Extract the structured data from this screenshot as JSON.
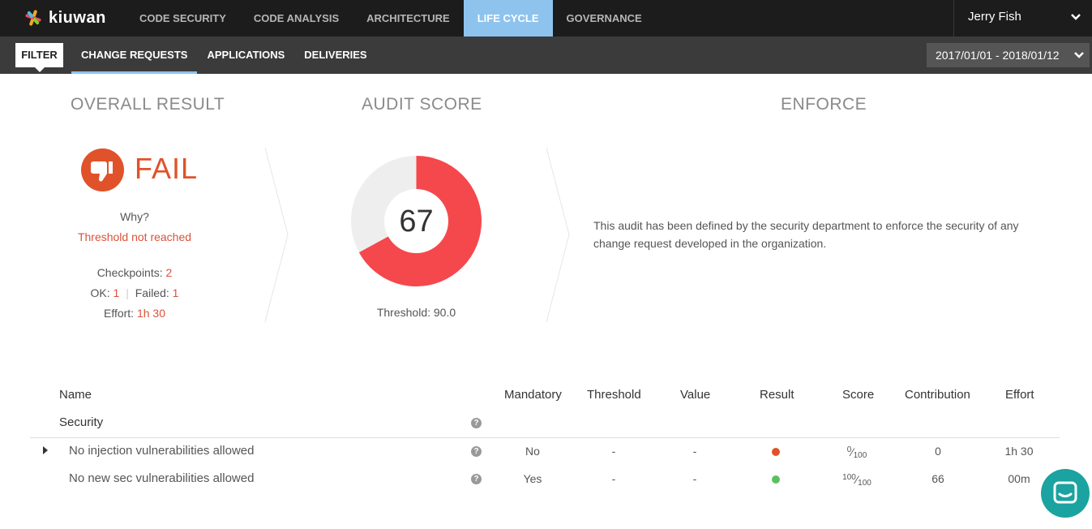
{
  "app": {
    "logo_text": "kiuwan"
  },
  "topnav": {
    "items": [
      {
        "label": "CODE SECURITY"
      },
      {
        "label": "CODE ANALYSIS"
      },
      {
        "label": "ARCHITECTURE"
      },
      {
        "label": "LIFE CYCLE",
        "active": true
      },
      {
        "label": "GOVERNANCE"
      }
    ],
    "user_name": "Jerry Fish"
  },
  "subnav": {
    "filter_label": "FILTER",
    "items": [
      {
        "label": "CHANGE REQUESTS",
        "active": true
      },
      {
        "label": "APPLICATIONS"
      },
      {
        "label": "DELIVERIES"
      }
    ],
    "date_range": "2017/01/01 - 2018/01/12"
  },
  "overall": {
    "title": "OVERALL RESULT",
    "result": "FAIL",
    "why_label": "Why?",
    "why_reason": "Threshold not reached",
    "checkpoints_label": "Checkpoints:",
    "checkpoints_value": "2",
    "ok_label": "OK:",
    "ok_value": "1",
    "sep": "|",
    "failed_label": "Failed:",
    "failed_value": "1",
    "effort_label": "Effort:",
    "effort_value": "1h 30"
  },
  "audit": {
    "title": "AUDIT SCORE",
    "score": "67",
    "score_fraction": 0.67,
    "threshold_text": "Threshold: 90.0"
  },
  "enforce": {
    "title": "ENFORCE",
    "description": "This audit has been defined by the security department to enforce the security of any change request developed in the organization."
  },
  "table": {
    "headers": [
      "Name",
      "Mandatory",
      "Threshold",
      "Value",
      "Result",
      "Score",
      "Contribution",
      "Effort"
    ],
    "group_name": "Security",
    "help_glyph": "?",
    "rows": [
      {
        "name": "No injection vulnerabilities allowed",
        "mandatory": "No",
        "threshold": "-",
        "value": "-",
        "result_color": "#e0522a",
        "score_num": "0",
        "score_den": "100",
        "contribution": "0",
        "effort": "1h 30"
      },
      {
        "name": "No new sec vulnerabilities allowed",
        "mandatory": "Yes",
        "threshold": "-",
        "value": "-",
        "result_color": "#5cc05c",
        "score_num": "100",
        "score_den": "100",
        "contribution": "66",
        "effort": "00m"
      }
    ]
  },
  "colors": {
    "accent": "#8ec3ee",
    "fail": "#e0522a",
    "donut_fill": "#f5484c",
    "donut_rest": "#eeeeee",
    "chat": "#1aa3a0"
  }
}
